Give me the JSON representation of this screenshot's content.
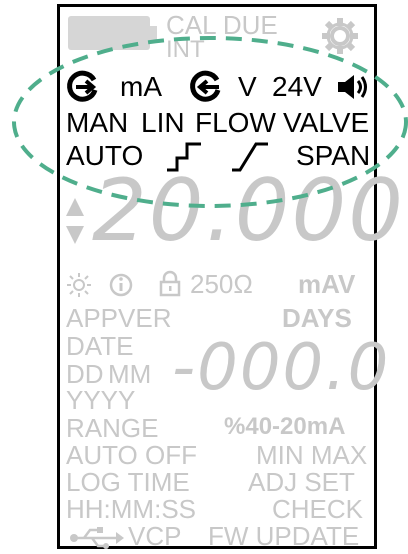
{
  "status": {
    "cal_due": "CAL DUE",
    "int": "INT"
  },
  "signal_row": {
    "unit_ma": "mA",
    "unit_v": "V",
    "supply_24v": "24V"
  },
  "mode_row": {
    "man": "MAN",
    "lin": "LIN",
    "flow": "FLOW",
    "valve": "VALVE"
  },
  "ramp_row": {
    "auto": "AUTO",
    "span": "SPAN"
  },
  "main_display": {
    "value": "20.000"
  },
  "info_row": {
    "resistor": "250Ω",
    "units": "mAV"
  },
  "labels": {
    "appver": "APPVER",
    "days": "DAYS",
    "date": "DATE",
    "dd": "DD",
    "mm": "MM",
    "yyyy": "YYYY",
    "range": "RANGE",
    "range_value": "%40-20mA",
    "auto_off": "AUTO OFF",
    "min_max": "MIN MAX",
    "log_time": "LOG TIME",
    "adj_set": "ADJ SET",
    "hhmmss": "HH:MM:SS",
    "check": "CHECK",
    "vcp": "VCP",
    "fw_update": "FW UPDATE"
  },
  "secondary_display": {
    "value": "-000.0"
  },
  "colors": {
    "active_segment": "#000000",
    "inactive_segment": "#c8c8c8",
    "highlight_ellipse": "#4fae8c"
  },
  "icons": {
    "battery": "battery-icon",
    "settings": "gear-icon",
    "source": "loop-source-icon",
    "sink": "loop-sink-icon",
    "speaker": "speaker-icon",
    "step_ramp": "step-ramp-icon",
    "linear_ramp": "linear-ramp-icon",
    "up_down": "up-down-arrows-icon",
    "backlight": "sun-icon",
    "info": "info-icon",
    "lock": "lock-icon",
    "usb": "usb-icon"
  }
}
